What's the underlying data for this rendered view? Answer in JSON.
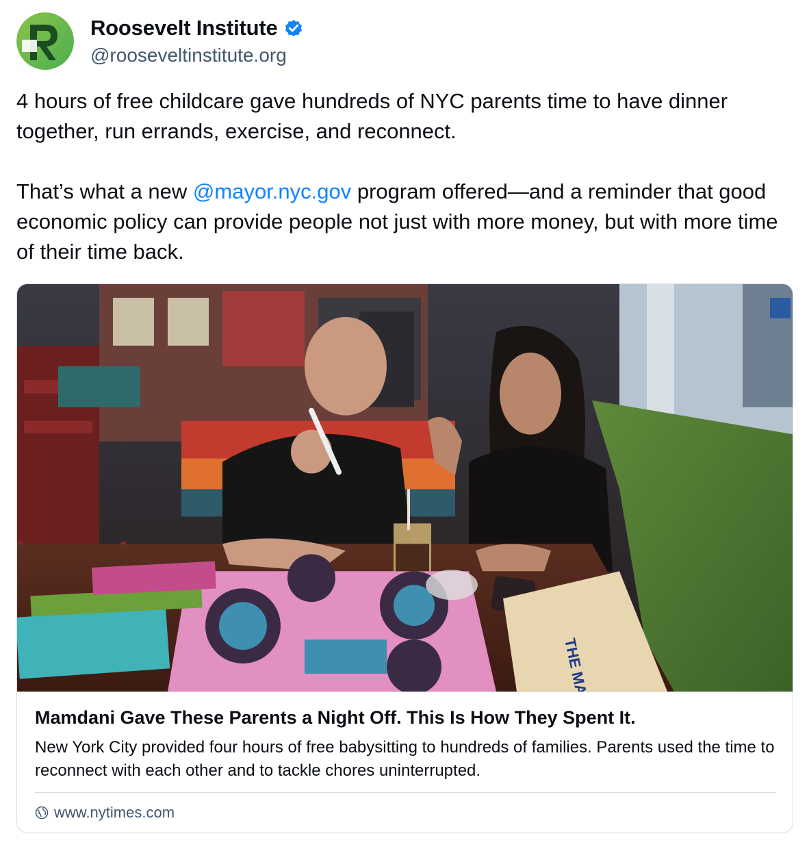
{
  "post": {
    "author": {
      "display_name": "Roosevelt Institute",
      "handle": "@rooseveltinstitute.org",
      "verified": true,
      "avatar_icon": "roosevelt-r-logo-icon"
    },
    "text": {
      "line1": "4 hours of free childcare gave hundreds of NYC parents time to have dinner together, run errands, exercise, and reconnect.",
      "line2_before": "That’s what a new ",
      "mention": "@mayor.nyc.gov",
      "line2_after": " program offered—and a reminder that good economic policy can provide people not just with more money, but with more time of their time back."
    },
    "link_card": {
      "title": "Mamdani Gave These Parents a Night Off. This Is How They Spent It.",
      "description": "New York City provided four hours of free babysitting to hundreds of families. Parents used the time to reconnect with each other and to tackle chores uninterrupted.",
      "domain": "www.nytimes.com",
      "domain_icon": "globe-icon",
      "image_icon": "article-thumbnail-image"
    }
  },
  "colors": {
    "text": "#0b0f14",
    "secondary": "#42576c",
    "link": "#1083fe",
    "border": "#d4dbe2",
    "verified": "#1083fe",
    "logo_green": "#2e7d32"
  }
}
